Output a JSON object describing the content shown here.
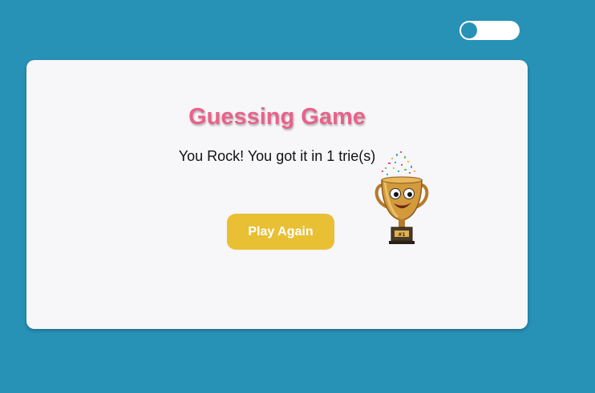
{
  "header": {
    "theme_toggle": {
      "state": "off",
      "icon": "toggle-switch-icon"
    }
  },
  "game": {
    "title": "Guessing Game",
    "result_message": "You Rock! You got it in 1 trie(s)",
    "play_again_label": "Play Again",
    "trophy_icon": "trophy-with-confetti-icon",
    "trophy_plate_text": "#1"
  },
  "colors": {
    "background": "#2891b6",
    "card": "#f7f6f9",
    "title": "#e8628a",
    "button": "#e9bf33"
  }
}
